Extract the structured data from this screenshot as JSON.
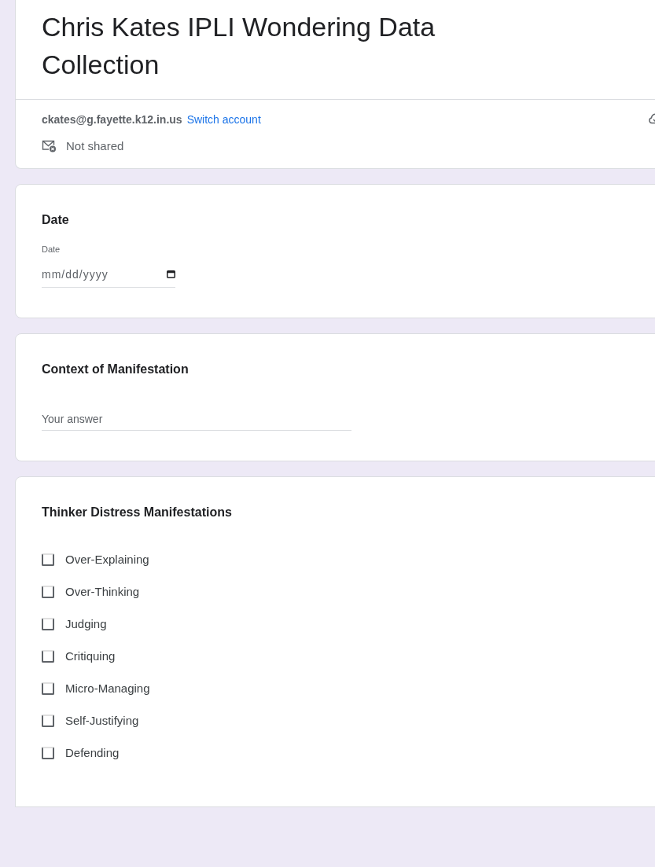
{
  "form": {
    "title": "Chris Kates IPLI Wondering Data Collection",
    "account_email": "ckates@g.fayette.k12.in.us",
    "switch_account": "Switch account",
    "sharing_status": "Not shared"
  },
  "questions": [
    {
      "kind": "date",
      "title": "Date",
      "field_label": "Date",
      "placeholder": "mm/dd/yyyy"
    },
    {
      "kind": "text",
      "title": "Context of Manifestation",
      "placeholder": "Your answer"
    },
    {
      "kind": "checkboxes",
      "title": "Thinker Distress Manifestations",
      "options": [
        {
          "label": "Over-Explaining",
          "checked": false
        },
        {
          "label": "Over-Thinking",
          "checked": false
        },
        {
          "label": "Judging",
          "checked": false
        },
        {
          "label": "Critiquing",
          "checked": false
        },
        {
          "label": "Micro-Managing",
          "checked": false
        },
        {
          "label": "Self-Justifying",
          "checked": false
        },
        {
          "label": "Defending",
          "checked": false
        }
      ]
    }
  ]
}
